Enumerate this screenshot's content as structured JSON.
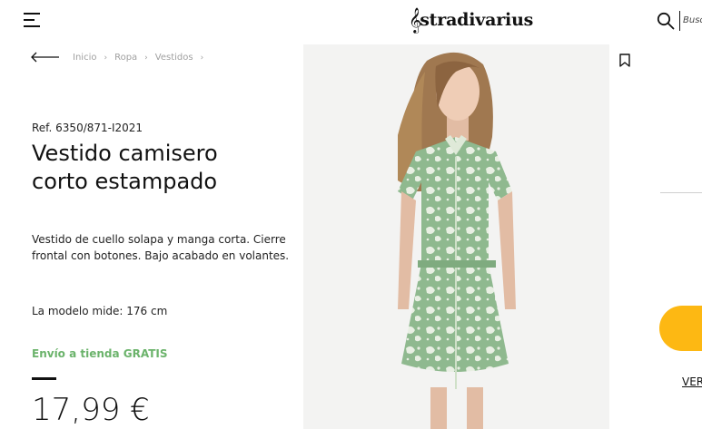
{
  "header": {
    "menu_icon": "hamburger-menu-icon",
    "logo_text": "stradivarius",
    "search_icon": "search-icon",
    "search_placeholder": "Busca"
  },
  "breadcrumb": {
    "back_icon": "arrow-left-icon",
    "items": [
      "Inicio",
      "Ropa",
      "Vestidos"
    ],
    "separator": "›"
  },
  "product": {
    "ref": "Ref. 6350/871-I2021",
    "title_line1": "Vestido camisero",
    "title_line2": "corto estampado",
    "description": "Vestido de cuello solapa y manga corta. Cierre frontal con botones. Bajo acabado en volantes.",
    "model_info": "La modelo mide: 176 cm",
    "shipping": "Envío a tienda GRATIS",
    "price": "17,99 €"
  },
  "side": {
    "bookmark_icon": "bookmark-icon",
    "ver_link": "VER"
  },
  "colors": {
    "accent_yellow": "#fdb813",
    "shipping_green": "#6bb36b",
    "breadcrumb_gray": "#a0a0a0",
    "dress_green": "#8fb98f"
  }
}
